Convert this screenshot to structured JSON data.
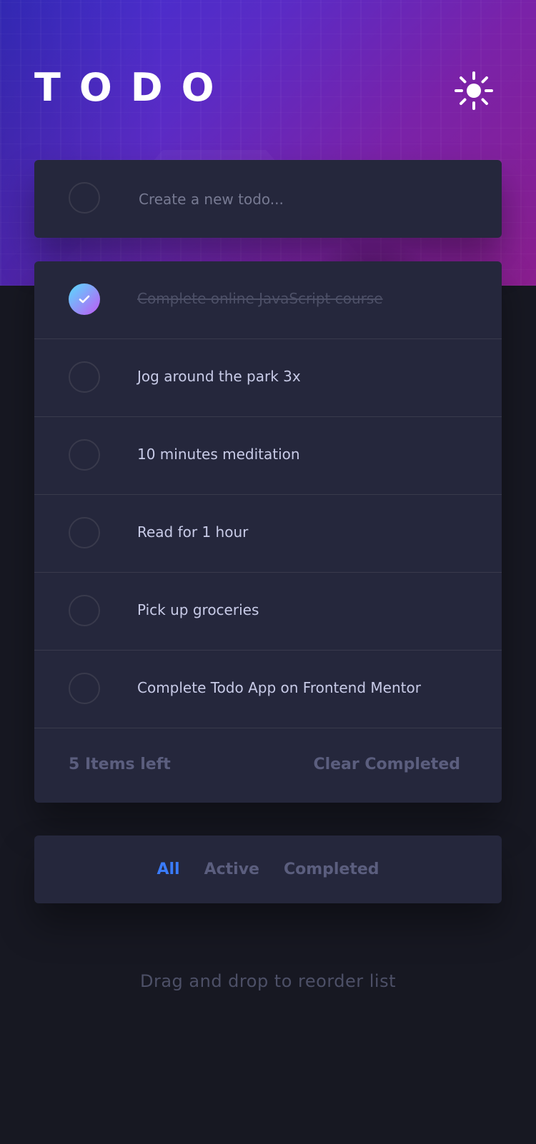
{
  "header": {
    "title": "TODO"
  },
  "theme": {
    "toggle_icon": "sun-icon"
  },
  "create": {
    "placeholder": "Create a new todo..."
  },
  "todos": [
    {
      "text": "Complete online JavaScript course",
      "completed": true
    },
    {
      "text": "Jog around the park 3x",
      "completed": false
    },
    {
      "text": "10 minutes meditation",
      "completed": false
    },
    {
      "text": "Read for 1 hour",
      "completed": false
    },
    {
      "text": "Pick up groceries",
      "completed": false
    },
    {
      "text": "Complete Todo App on Frontend Mentor",
      "completed": false
    }
  ],
  "footer": {
    "items_left": "5 Items left",
    "clear_completed": "Clear Completed"
  },
  "filters": {
    "all": "All",
    "active": "Active",
    "completed": "Completed",
    "selected": "All"
  },
  "hint": {
    "drag_text": "Drag and drop to reorder list"
  },
  "colors": {
    "accent_blue": "#3a7cfd",
    "check_gradient_start": "#57ddff",
    "check_gradient_end": "#c058f3",
    "card_bg": "#25273c",
    "page_bg": "#171822"
  }
}
